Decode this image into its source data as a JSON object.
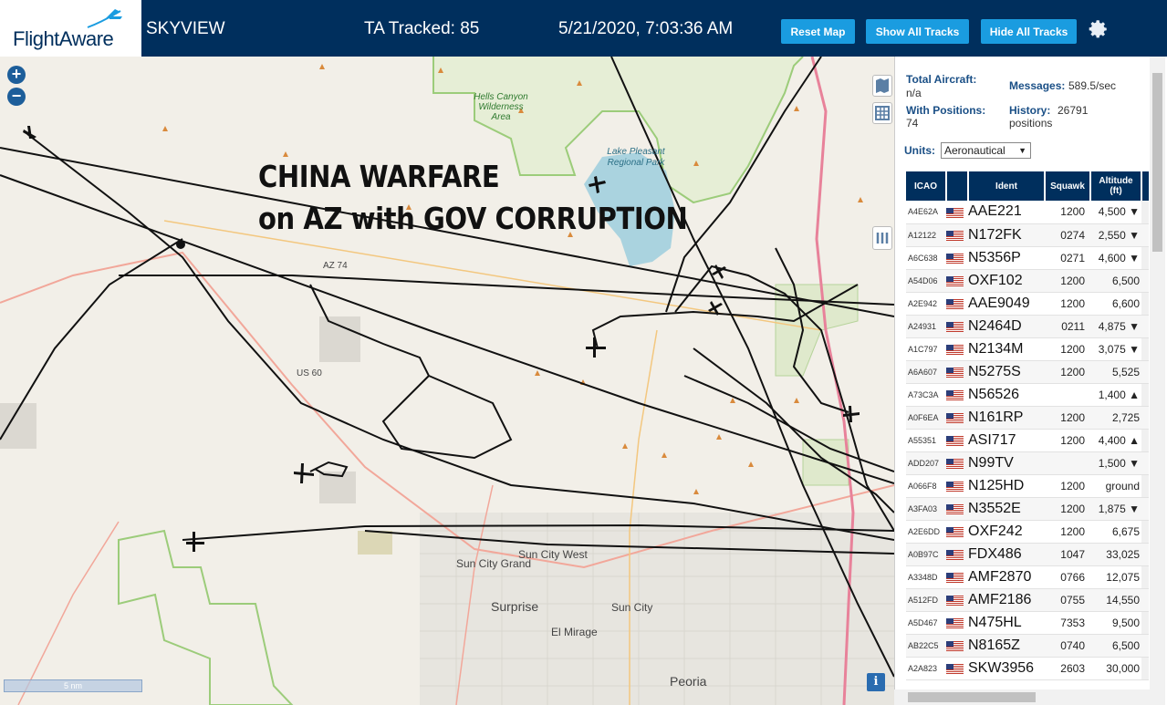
{
  "header": {
    "brand": "FlightAware",
    "title": "SKYVIEW",
    "tracked": "TA Tracked: 85",
    "datetime": "5/21/2020, 7:03:36 AM",
    "buttons": {
      "reset_map": "Reset Map",
      "show_all": "Show All Tracks",
      "hide_all": "Hide All Tracks"
    }
  },
  "map": {
    "overlay_line1": "CHINA WARFARE",
    "overlay_line2": "on AZ with GOV CORRUPTION",
    "labels": {
      "hells_canyon": "Hells Canyon Wilderness Area",
      "lake_pleasant": "Lake Pleasant Regional Park",
      "az74": "AZ 74",
      "us60": "US 60",
      "sun_city_grand": "Sun City Grand",
      "sun_city_west": "Sun City West",
      "surprise": "Surprise",
      "sun_city": "Sun City",
      "el_mirage": "El Mirage",
      "peoria": "Peoria"
    },
    "scale": "5 nm",
    "zoom_in": "+",
    "zoom_out": "−",
    "info": "i"
  },
  "panel": {
    "stats": {
      "total_aircraft_label": "Total Aircraft:",
      "total_aircraft_value": "n/a",
      "with_positions_label": "With Positions:",
      "with_positions_value": "74",
      "messages_label": "Messages:",
      "messages_value": "589.5/sec",
      "history_label": "History:",
      "history_value": "26791",
      "history_unit": "positions"
    },
    "units_label": "Units:",
    "units_value": "Aeronautical",
    "columns": {
      "icao": "ICAO",
      "ident": "Ident",
      "squawk": "Squawk",
      "altitude": "Altitude",
      "altitude_unit": "(ft)"
    },
    "rows": [
      {
        "icao": "A4E62A",
        "ident": "AAE221",
        "squawk": "1200",
        "alt": "4,500 ▼"
      },
      {
        "icao": "A12122",
        "ident": "N172FK",
        "squawk": "0274",
        "alt": "2,550 ▼"
      },
      {
        "icao": "A6C638",
        "ident": "N5356P",
        "squawk": "0271",
        "alt": "4,600 ▼"
      },
      {
        "icao": "A54D06",
        "ident": "OXF102",
        "squawk": "1200",
        "alt": "6,500"
      },
      {
        "icao": "A2E942",
        "ident": "AAE9049",
        "squawk": "1200",
        "alt": "6,600"
      },
      {
        "icao": "A24931",
        "ident": "N2464D",
        "squawk": "0211",
        "alt": "4,875 ▼"
      },
      {
        "icao": "A1C797",
        "ident": "N2134M",
        "squawk": "1200",
        "alt": "3,075 ▼"
      },
      {
        "icao": "A6A607",
        "ident": "N5275S",
        "squawk": "1200",
        "alt": "5,525"
      },
      {
        "icao": "A73C3A",
        "ident": "N56526",
        "squawk": "",
        "alt": "1,400 ▲"
      },
      {
        "icao": "A0F6EA",
        "ident": "N161RP",
        "squawk": "1200",
        "alt": "2,725"
      },
      {
        "icao": "A55351",
        "ident": "ASI717",
        "squawk": "1200",
        "alt": "4,400 ▲"
      },
      {
        "icao": "ADD207",
        "ident": "N99TV",
        "squawk": "",
        "alt": "1,500 ▼"
      },
      {
        "icao": "A066F8",
        "ident": "N125HD",
        "squawk": "1200",
        "alt": "ground"
      },
      {
        "icao": "A3FA03",
        "ident": "N3552E",
        "squawk": "1200",
        "alt": "1,875 ▼"
      },
      {
        "icao": "A2E6DD",
        "ident": "OXF242",
        "squawk": "1200",
        "alt": "6,675"
      },
      {
        "icao": "A0B97C",
        "ident": "FDX486",
        "squawk": "1047",
        "alt": "33,025"
      },
      {
        "icao": "A3348D",
        "ident": "AMF2870",
        "squawk": "0766",
        "alt": "12,075"
      },
      {
        "icao": "A512FD",
        "ident": "AMF2186",
        "squawk": "0755",
        "alt": "14,550"
      },
      {
        "icao": "A5D467",
        "ident": "N475HL",
        "squawk": "7353",
        "alt": "9,500"
      },
      {
        "icao": "AB22C5",
        "ident": "N8165Z",
        "squawk": "0740",
        "alt": "6,500"
      },
      {
        "icao": "A2A823",
        "ident": "SKW3956",
        "squawk": "2603",
        "alt": "30,000"
      }
    ]
  },
  "colors": {
    "header_bg": "#002f5d",
    "button_bg": "#1a9ce0",
    "track": "#111111"
  }
}
